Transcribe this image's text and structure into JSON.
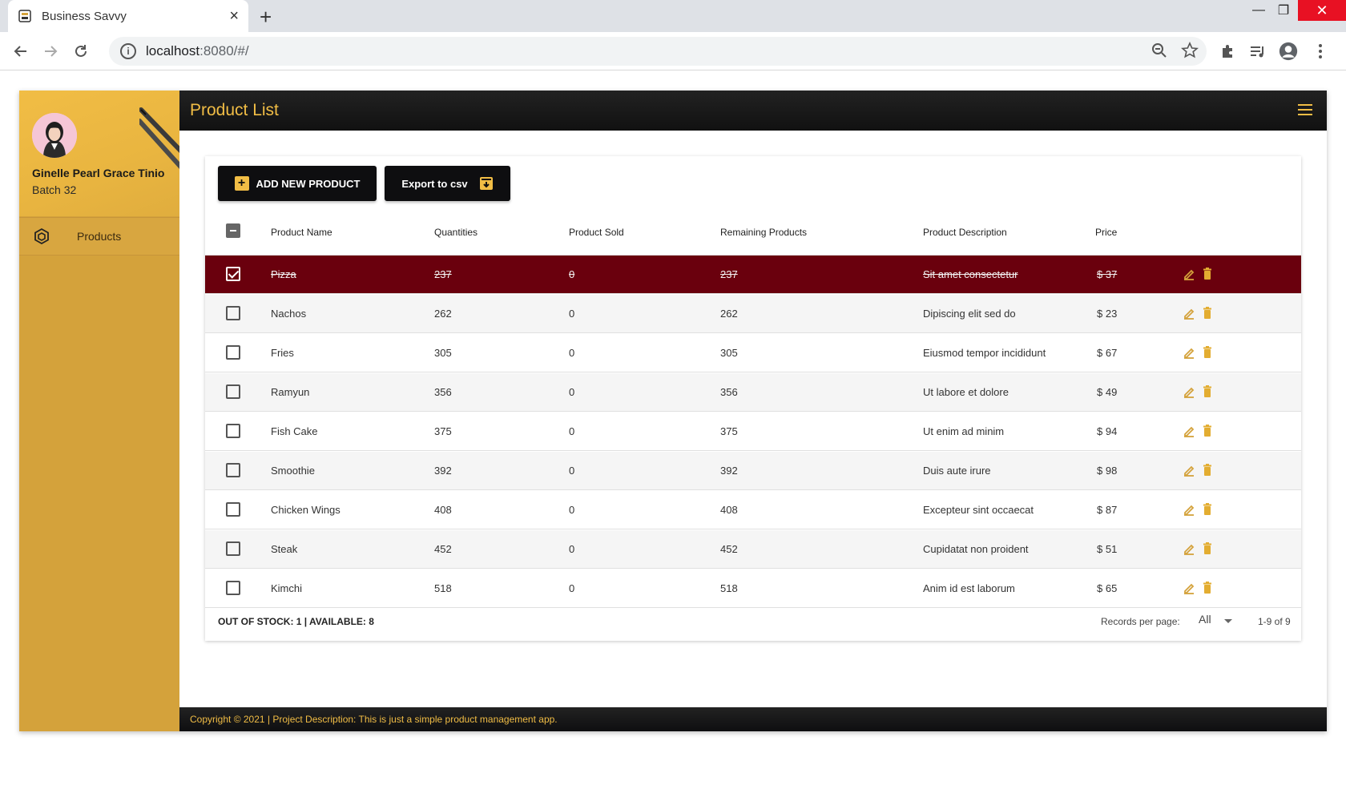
{
  "browser": {
    "tab_title": "Business Savvy",
    "url_host": "localhost",
    "url_rest": ":8080/#/"
  },
  "sidebar": {
    "user_name": "Ginelle Pearl Grace Tinio",
    "batch": "Batch 32",
    "items": [
      {
        "label": "Products",
        "icon": "cube-icon"
      }
    ]
  },
  "header": {
    "title": "Product List"
  },
  "toolbar": {
    "add_label": "ADD NEW PRODUCT",
    "export_label": "Export to csv"
  },
  "table": {
    "columns": [
      "Product Name",
      "Quantities",
      "Product Sold",
      "Remaining Products",
      "Product Description",
      "Price"
    ],
    "rows": [
      {
        "name": "Pizza",
        "qty": "237",
        "sold": "0",
        "remaining": "237",
        "description": "Sit amet consectetur",
        "price": "$ 37",
        "checked": true
      },
      {
        "name": "Nachos",
        "qty": "262",
        "sold": "0",
        "remaining": "262",
        "description": "Dipiscing elit sed do",
        "price": "$ 23",
        "checked": false
      },
      {
        "name": "Fries",
        "qty": "305",
        "sold": "0",
        "remaining": "305",
        "description": "Eiusmod tempor incididunt",
        "price": "$ 67",
        "checked": false
      },
      {
        "name": "Ramyun",
        "qty": "356",
        "sold": "0",
        "remaining": "356",
        "description": "Ut labore et dolore",
        "price": "$ 49",
        "checked": false
      },
      {
        "name": "Fish Cake",
        "qty": "375",
        "sold": "0",
        "remaining": "375",
        "description": "Ut enim ad minim",
        "price": "$ 94",
        "checked": false
      },
      {
        "name": "Smoothie",
        "qty": "392",
        "sold": "0",
        "remaining": "392",
        "description": "Duis aute irure",
        "price": "$ 98",
        "checked": false
      },
      {
        "name": "Chicken Wings",
        "qty": "408",
        "sold": "0",
        "remaining": "408",
        "description": "Excepteur sint occaecat",
        "price": "$ 87",
        "checked": false
      },
      {
        "name": "Steak",
        "qty": "452",
        "sold": "0",
        "remaining": "452",
        "description": "Cupidatat non proident",
        "price": "$ 51",
        "checked": false
      },
      {
        "name": "Kimchi",
        "qty": "518",
        "sold": "0",
        "remaining": "518",
        "description": "Anim id est laborum",
        "price": "$ 65",
        "checked": false
      }
    ]
  },
  "footer_bar": {
    "stock_summary": "OUT OF STOCK: 1 | AVAILABLE: 8",
    "records_label": "Records per page:",
    "records_value": "All",
    "range": "1-9 of 9"
  },
  "footer": {
    "text": "Copyright © 2021 | Project Description: This is just a simple product management app."
  },
  "colors": {
    "accent": "#f1bd45",
    "sidebar": "#d4a23b",
    "selected_row": "#6a000d",
    "dark": "#111111"
  }
}
